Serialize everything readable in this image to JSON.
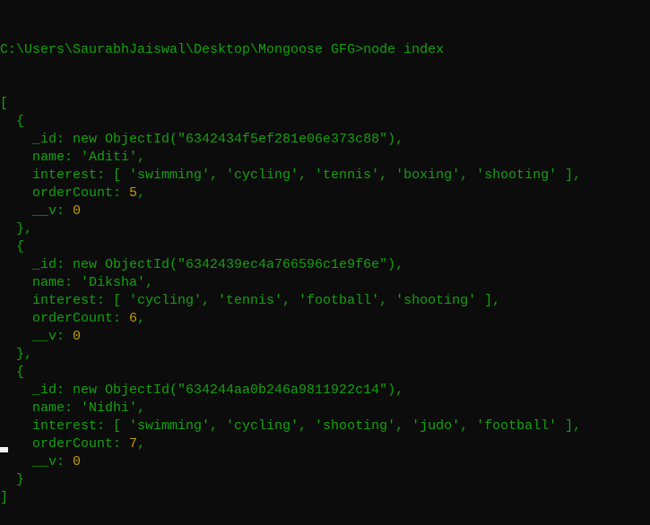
{
  "terminal": {
    "prompt": "C:\\Users\\SaurabhJaiswal\\Desktop\\Mongoose GFG>",
    "command": "node index",
    "colors": {
      "background": "#0c0c0c",
      "text": "#13a10e",
      "number": "#c19c00",
      "cursor": "#f2f2f2"
    },
    "output": {
      "documents": [
        {
          "id": "6342434f5ef281e06e373c88",
          "name": "Aditi",
          "interest": [
            "swimming",
            "cycling",
            "tennis",
            "boxing",
            "shooting"
          ],
          "orderCount": 5,
          "v": 0
        },
        {
          "id": "6342439ec4a766596c1e9f6e",
          "name": "Diksha",
          "interest": [
            "cycling",
            "tennis",
            "football",
            "shooting"
          ],
          "orderCount": 6,
          "v": 0
        },
        {
          "id": "634244aa0b246a9811922c14",
          "name": "Nidhi",
          "interest": [
            "swimming",
            "cycling",
            "shooting",
            "judo",
            "football"
          ],
          "orderCount": 7,
          "v": 0
        }
      ]
    }
  }
}
